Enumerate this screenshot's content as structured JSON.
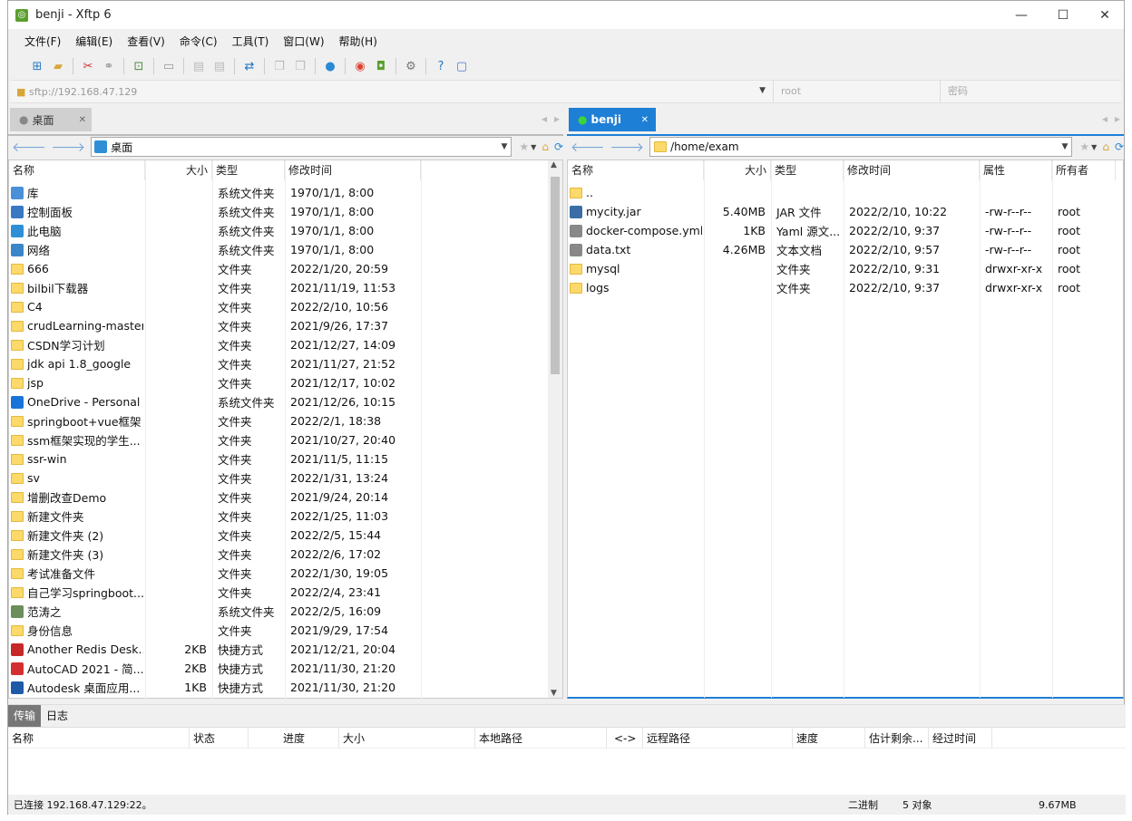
{
  "window": {
    "title": "benji    - Xftp 6",
    "app_icon": "xftp-icon"
  },
  "menu": [
    "文件(F)",
    "编辑(E)",
    "查看(V)",
    "命令(C)",
    "工具(T)",
    "窗口(W)",
    "帮助(H)"
  ],
  "address": {
    "url": "sftp://192.168.47.129",
    "user_placeholder": "root",
    "password_placeholder": "密码"
  },
  "left": {
    "tab": "桌面",
    "path": "桌面",
    "columns": [
      "名称",
      "大小",
      "类型",
      "修改时间"
    ],
    "rows": [
      {
        "name": "库",
        "size": "",
        "type": "系统文件夹",
        "mtime": "1970/1/1, 8:00",
        "icon": "library-icon",
        "color": "#4a90d9"
      },
      {
        "name": "控制面板",
        "size": "",
        "type": "系统文件夹",
        "mtime": "1970/1/1, 8:00",
        "icon": "control-panel-icon",
        "color": "#3b78c4"
      },
      {
        "name": "此电脑",
        "size": "",
        "type": "系统文件夹",
        "mtime": "1970/1/1, 8:00",
        "icon": "computer-icon",
        "color": "#2f8fd6"
      },
      {
        "name": "网络",
        "size": "",
        "type": "系统文件夹",
        "mtime": "1970/1/1, 8:00",
        "icon": "network-icon",
        "color": "#3a86c8"
      },
      {
        "name": "666",
        "size": "",
        "type": "文件夹",
        "mtime": "2022/1/20, 20:59",
        "icon": "folder-icon"
      },
      {
        "name": "bilbil下载器",
        "size": "",
        "type": "文件夹",
        "mtime": "2021/11/19, 11:53",
        "icon": "folder-icon"
      },
      {
        "name": "C4",
        "size": "",
        "type": "文件夹",
        "mtime": "2022/2/10, 10:56",
        "icon": "folder-icon"
      },
      {
        "name": "crudLearning-master",
        "size": "",
        "type": "文件夹",
        "mtime": "2021/9/26, 17:37",
        "icon": "folder-icon"
      },
      {
        "name": "CSDN学习计划",
        "size": "",
        "type": "文件夹",
        "mtime": "2021/12/27, 14:09",
        "icon": "folder-icon"
      },
      {
        "name": "jdk api 1.8_google",
        "size": "",
        "type": "文件夹",
        "mtime": "2021/11/27, 21:52",
        "icon": "folder-icon"
      },
      {
        "name": "jsp",
        "size": "",
        "type": "文件夹",
        "mtime": "2021/12/17, 10:02",
        "icon": "folder-icon"
      },
      {
        "name": "OneDrive - Personal",
        "size": "",
        "type": "系统文件夹",
        "mtime": "2021/12/26, 10:15",
        "icon": "onedrive-icon",
        "color": "#1a73d9"
      },
      {
        "name": "springboot+vue框架",
        "size": "",
        "type": "文件夹",
        "mtime": "2022/2/1, 18:38",
        "icon": "folder-icon"
      },
      {
        "name": "ssm框架实现的学生...",
        "size": "",
        "type": "文件夹",
        "mtime": "2021/10/27, 20:40",
        "icon": "folder-icon"
      },
      {
        "name": "ssr-win",
        "size": "",
        "type": "文件夹",
        "mtime": "2021/11/5, 11:15",
        "icon": "folder-icon"
      },
      {
        "name": "sv",
        "size": "",
        "type": "文件夹",
        "mtime": "2022/1/31, 13:24",
        "icon": "folder-icon"
      },
      {
        "name": "增删改查Demo",
        "size": "",
        "type": "文件夹",
        "mtime": "2021/9/24, 20:14",
        "icon": "folder-icon"
      },
      {
        "name": "新建文件夹",
        "size": "",
        "type": "文件夹",
        "mtime": "2022/1/25, 11:03",
        "icon": "folder-icon"
      },
      {
        "name": "新建文件夹 (2)",
        "size": "",
        "type": "文件夹",
        "mtime": "2022/2/5, 15:44",
        "icon": "folder-icon"
      },
      {
        "name": "新建文件夹 (3)",
        "size": "",
        "type": "文件夹",
        "mtime": "2022/2/6, 17:02",
        "icon": "folder-icon"
      },
      {
        "name": "考试准备文件",
        "size": "",
        "type": "文件夹",
        "mtime": "2022/1/30, 19:05",
        "icon": "folder-icon"
      },
      {
        "name": "自己学习springboot...",
        "size": "",
        "type": "文件夹",
        "mtime": "2022/2/4, 23:41",
        "icon": "folder-icon"
      },
      {
        "name": "范涛之",
        "size": "",
        "type": "系统文件夹",
        "mtime": "2022/2/5, 16:09",
        "icon": "user-folder-icon",
        "color": "#6b8e5a"
      },
      {
        "name": "身份信息",
        "size": "",
        "type": "文件夹",
        "mtime": "2021/9/29, 17:54",
        "icon": "folder-icon"
      },
      {
        "name": "Another Redis Desk...",
        "size": "2KB",
        "type": "快捷方式",
        "mtime": "2021/12/21, 20:04",
        "icon": "redis-icon",
        "color": "#c62828"
      },
      {
        "name": "AutoCAD 2021 - 简...",
        "size": "2KB",
        "type": "快捷方式",
        "mtime": "2021/11/30, 21:20",
        "icon": "autocad-icon",
        "color": "#d32f2f"
      },
      {
        "name": "Autodesk 桌面应用...",
        "size": "1KB",
        "type": "快捷方式",
        "mtime": "2021/11/30, 21:20",
        "icon": "autodesk-icon",
        "color": "#1e5aa8"
      }
    ]
  },
  "right": {
    "tab": "benji",
    "path": "/home/exam",
    "columns": [
      "名称",
      "大小",
      "类型",
      "修改时间",
      "属性",
      "所有者"
    ],
    "rows": [
      {
        "name": "..",
        "size": "",
        "type": "",
        "mtime": "",
        "attr": "",
        "owner": "",
        "icon": "folder-icon"
      },
      {
        "name": "mycity.jar",
        "size": "5.40MB",
        "type": "JAR 文件",
        "mtime": "2022/2/10, 10:22",
        "attr": "-rw-r--r--",
        "owner": "root",
        "icon": "jar-icon",
        "color": "#3a6ea5"
      },
      {
        "name": "docker-compose.yml",
        "size": "1KB",
        "type": "Yaml 源文...",
        "mtime": "2022/2/10, 9:37",
        "attr": "-rw-r--r--",
        "owner": "root",
        "icon": "yaml-file-icon",
        "color": "#888"
      },
      {
        "name": "data.txt",
        "size": "4.26MB",
        "type": "文本文档",
        "mtime": "2022/2/10, 9:57",
        "attr": "-rw-r--r--",
        "owner": "root",
        "icon": "text-file-icon",
        "color": "#888"
      },
      {
        "name": "mysql",
        "size": "",
        "type": "文件夹",
        "mtime": "2022/2/10, 9:31",
        "attr": "drwxr-xr-x",
        "owner": "root",
        "icon": "folder-icon"
      },
      {
        "name": "logs",
        "size": "",
        "type": "文件夹",
        "mtime": "2022/2/10, 9:37",
        "attr": "drwxr-xr-x",
        "owner": "root",
        "icon": "folder-icon"
      }
    ]
  },
  "bottom": {
    "tabs": [
      "传输",
      "日志"
    ],
    "columns": [
      "名称",
      "状态",
      "进度",
      "大小",
      "本地路径",
      "<->",
      "远程路径",
      "速度",
      "估计剩余...",
      "经过时间"
    ]
  },
  "status": {
    "connection": "已连接 192.168.47.129:22。",
    "mode": "二进制",
    "count": "5 对象",
    "size": "9.67MB"
  }
}
